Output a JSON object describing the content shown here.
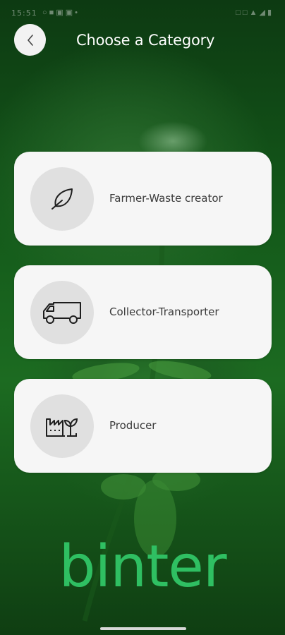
{
  "status_bar": {
    "time": "15:51",
    "left_icons": [
      "notification-icon",
      "lock-icon",
      "app-icon",
      "app-icon",
      "dot-icon"
    ],
    "right_icons": [
      "mute-icon",
      "vibrate-icon",
      "wifi-icon",
      "signal-icon",
      "battery-icon"
    ]
  },
  "header": {
    "back_icon": "chevron-left-icon",
    "title": "Choose a Category"
  },
  "categories": [
    {
      "label": "Farmer-Waste creator",
      "icon": "leaf-icon"
    },
    {
      "label": "Collector-Transporter",
      "icon": "truck-icon"
    },
    {
      "label": "Producer",
      "icon": "factory-sprout-icon"
    }
  ],
  "brand": {
    "logo_text": "binter",
    "color": "#2fbf62"
  },
  "colors": {
    "card_bg": "#f6f6f6",
    "icon_circle": "#e0e0e0",
    "text": "#3a3a3a"
  }
}
